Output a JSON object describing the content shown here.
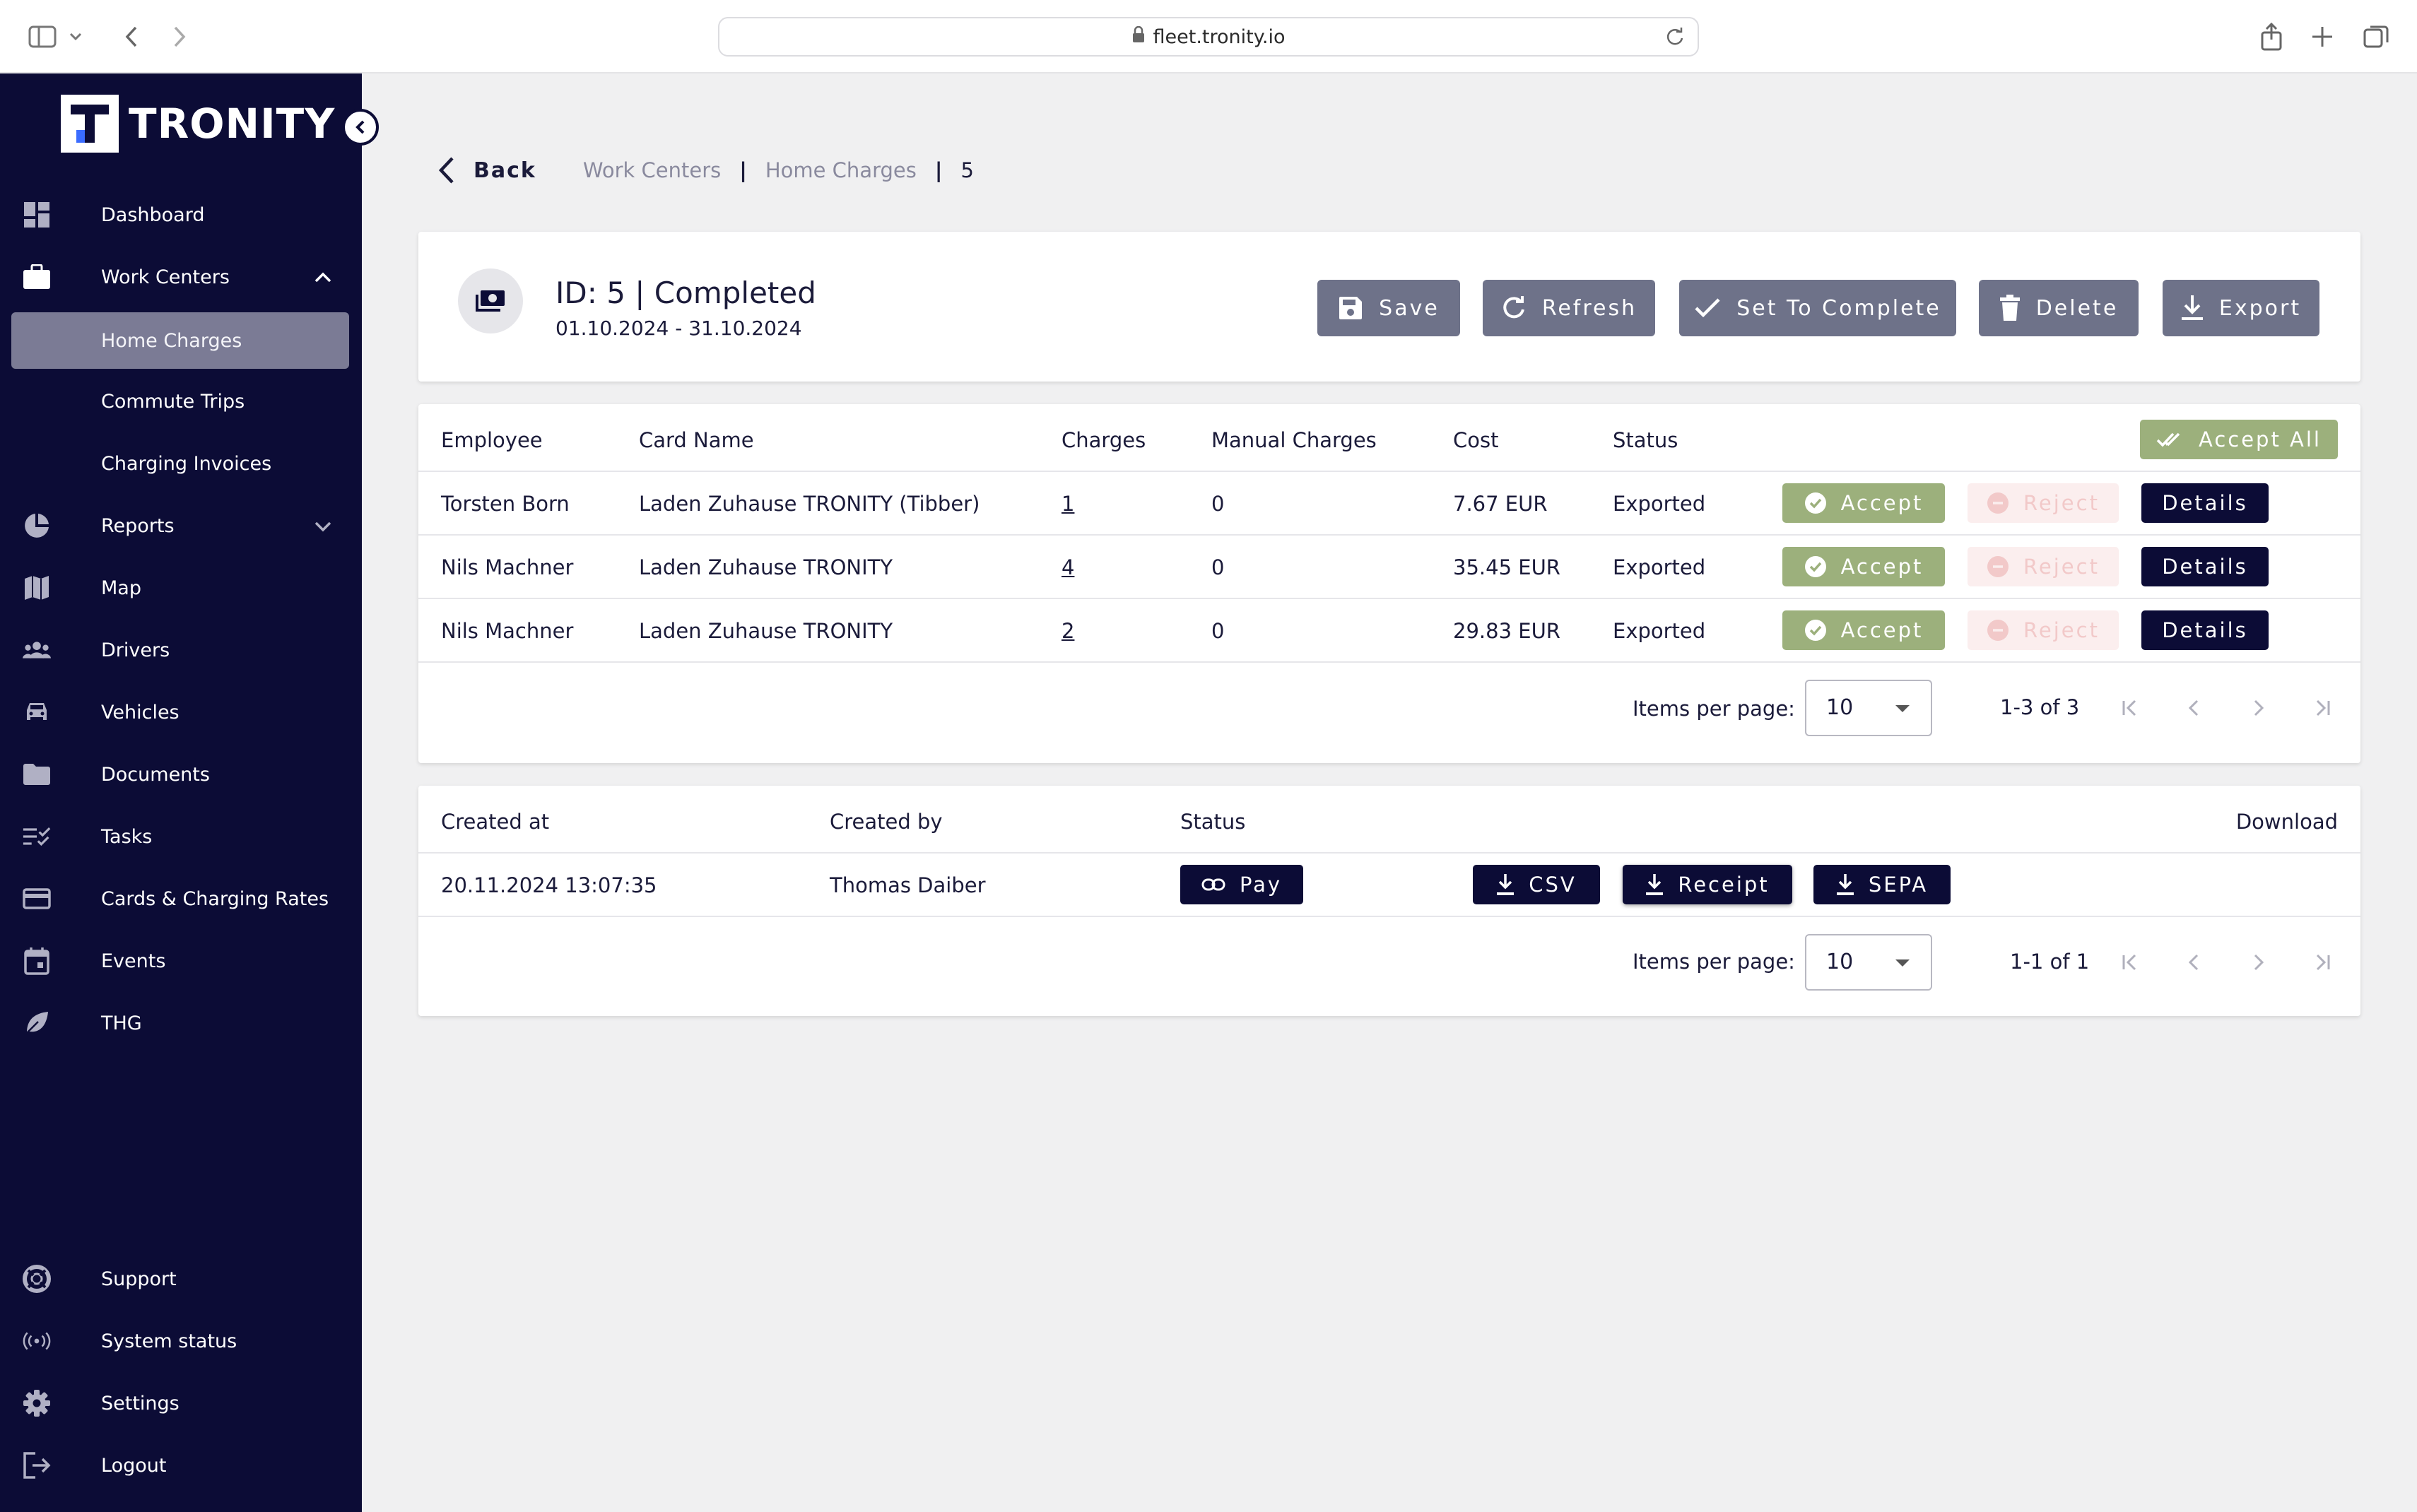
{
  "browser": {
    "url": "fleet.tronity.io"
  },
  "sidebar": {
    "brand": "TRONITY",
    "items": [
      {
        "label": "Dashboard",
        "icon": "dashboard-icon"
      },
      {
        "label": "Work Centers",
        "icon": "briefcase-icon",
        "expanded": true
      },
      {
        "label": "Home Charges",
        "sub": true,
        "active": true
      },
      {
        "label": "Commute Trips",
        "sub": true
      },
      {
        "label": "Charging Invoices",
        "sub": true
      },
      {
        "label": "Reports",
        "icon": "pie-chart-icon",
        "expanded": false
      },
      {
        "label": "Map",
        "icon": "map-icon"
      },
      {
        "label": "Drivers",
        "icon": "people-icon"
      },
      {
        "label": "Vehicles",
        "icon": "car-icon"
      },
      {
        "label": "Documents",
        "icon": "folder-icon"
      },
      {
        "label": "Tasks",
        "icon": "checklist-icon"
      },
      {
        "label": "Cards & Charging Rates",
        "icon": "credit-card-icon"
      },
      {
        "label": "Events",
        "icon": "calendar-icon"
      },
      {
        "label": "THG",
        "icon": "leaf-icon"
      }
    ],
    "bottom_items": [
      {
        "label": "Support",
        "icon": "lifebuoy-icon"
      },
      {
        "label": "System status",
        "icon": "broadcast-icon"
      },
      {
        "label": "Settings",
        "icon": "gear-icon"
      },
      {
        "label": "Logout",
        "icon": "logout-icon"
      }
    ]
  },
  "topbar": {
    "back_label": "Back",
    "breadcrumb": [
      "Work Centers",
      "Home Charges",
      "5"
    ]
  },
  "header": {
    "title": "ID: 5 | Completed",
    "period": "01.10.2024 - 31.10.2024",
    "buttons": {
      "save": "Save",
      "refresh": "Refresh",
      "complete": "Set To Complete",
      "delete": "Delete",
      "export": "Export"
    }
  },
  "charges_table": {
    "columns": [
      "Employee",
      "Card Name",
      "Charges",
      "Manual Charges",
      "Cost",
      "Status"
    ],
    "accept_all_label": "Accept All",
    "accept_label": "Accept",
    "reject_label": "Reject",
    "details_label": "Details",
    "rows": [
      {
        "employee": "Torsten Born",
        "card": "Laden Zuhause TRONITY (Tibber)",
        "charges": "1",
        "manual": "0",
        "cost": "7.67 EUR",
        "status": "Exported"
      },
      {
        "employee": "Nils Machner",
        "card": "Laden Zuhause TRONITY",
        "charges": "4",
        "manual": "0",
        "cost": "35.45 EUR",
        "status": "Exported"
      },
      {
        "employee": "Nils Machner",
        "card": "Laden Zuhause TRONITY",
        "charges": "2",
        "manual": "0",
        "cost": "29.83 EUR",
        "status": "Exported"
      }
    ],
    "pagination": {
      "items_per_page_label": "Items per page:",
      "items_per_page": "10",
      "range": "1-3 of 3"
    }
  },
  "exports_table": {
    "columns": [
      "Created at",
      "Created by",
      "Status",
      "Download"
    ],
    "rows": [
      {
        "created_at": "20.11.2024 13:07:35",
        "created_by": "Thomas Daiber",
        "status_button": "Pay",
        "csv": "CSV",
        "receipt": "Receipt",
        "sepa": "SEPA"
      }
    ],
    "pagination": {
      "items_per_page_label": "Items per page:",
      "items_per_page": "10",
      "range": "1-1 of 1"
    }
  },
  "colors": {
    "sidebar_bg": "#0c0c36",
    "active_nav": "#7b7b95",
    "header_button": "#6e7289",
    "accept": "#9cb07c",
    "reject_bg": "#fbeeee",
    "dark_button": "#0c0c36"
  }
}
